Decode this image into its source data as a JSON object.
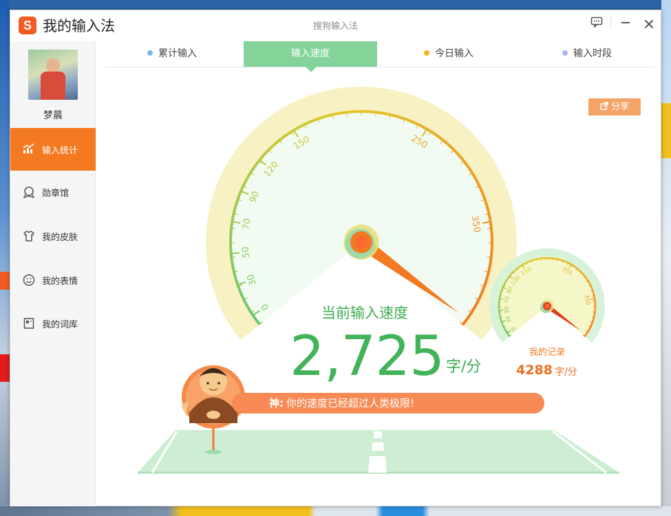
{
  "app": {
    "logo_letter": "S",
    "title": "我的输入法",
    "center_title": "搜狗输入法"
  },
  "user": {
    "name": "梦晨"
  },
  "sidebar": {
    "items": [
      {
        "label": "输入统计",
        "icon": "chart-icon",
        "active": true
      },
      {
        "label": "勋章馆",
        "icon": "medal-icon",
        "active": false
      },
      {
        "label": "我的皮肤",
        "icon": "shirt-icon",
        "active": false
      },
      {
        "label": "我的表情",
        "icon": "smiley-icon",
        "active": false
      },
      {
        "label": "我的词库",
        "icon": "book-icon",
        "active": false
      }
    ]
  },
  "tabs": [
    {
      "label": "累计输入",
      "dot_color": "#7fb8f0",
      "active": false
    },
    {
      "label": "输入速度",
      "dot_color": "",
      "active": true
    },
    {
      "label": "今日输入",
      "dot_color": "#f5b31a",
      "active": false
    },
    {
      "label": "输入时段",
      "dot_color": "#a9b6e8",
      "active": false
    }
  ],
  "share_label": "分享",
  "gauge": {
    "ticks": [
      "0",
      "30",
      "50",
      "70",
      "90",
      "120",
      "150",
      "250",
      "350"
    ],
    "speed_label": "当前输入速度",
    "speed_value": "2,725",
    "speed_unit": "字/分",
    "needle_value": 350
  },
  "record": {
    "ticks": [
      "0",
      "30",
      "50",
      "70",
      "90",
      "120",
      "150",
      "250",
      "350"
    ],
    "label": "我的记录",
    "value": "4288",
    "unit": "字/分",
    "needle_value": 350
  },
  "achievement": {
    "level": "神:",
    "message": "你的速度已经超过人类极限!"
  },
  "colors": {
    "accent_orange": "#f47a22",
    "tab_green": "#84d49a",
    "speed_green": "#43b35a",
    "gauge_fill": "#f1fbf2",
    "gauge_rim": "#f7f1c4"
  }
}
